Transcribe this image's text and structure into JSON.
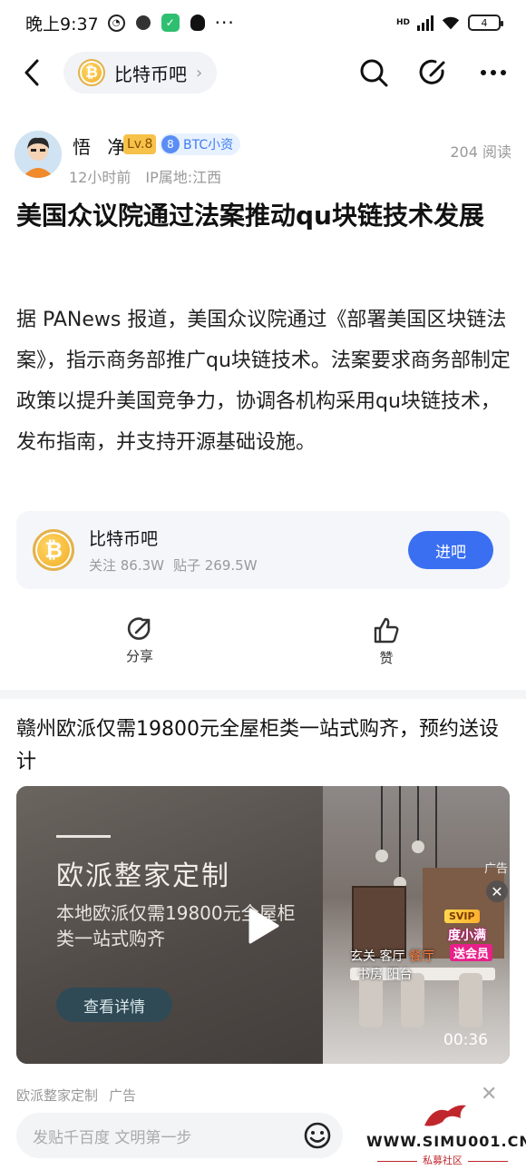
{
  "status_bar": {
    "time": "晚上9:37",
    "battery": "4",
    "network": "HD"
  },
  "nav": {
    "forum_name": "比特币吧",
    "chevron": "›"
  },
  "author": {
    "name": "悟 净",
    "level": "Lv.8",
    "title_num": "8",
    "title": "BTC小资",
    "time_ago": "12小时前",
    "ip_location": "IP属地:江西",
    "views": "204 阅读"
  },
  "post": {
    "title": "美国众议院通过法案推动qu块链技术发展",
    "body": "据 PANews 报道，美国众议院通过《部署美国区块链法案》，指示商务部推广qu块链技术。法案要求商务部制定政策以提升美国竞争力，协调各机构采用qu块链技术，发布指南，并支持开源基础设施。"
  },
  "forum_card": {
    "name": "比特币吧",
    "followers": "关注 86.3W",
    "posts": "贴子 269.5W",
    "join_label": "进吧",
    "coin_symbol": "₿"
  },
  "actions": {
    "share": "分享",
    "like": "赞"
  },
  "ad": {
    "title": "赣州欧派仅需19800元全屋柜类一站式购齐，预约送设计",
    "brand": "欧派整家定制",
    "desc": "本地欧派仅需19800元全屋柜类一站式购齐",
    "cta": "查看详情",
    "ad_mark": "广告",
    "rooms_line1_a": "玄关",
    "rooms_line1_b": "客厅",
    "rooms_line1_c": "餐厅",
    "rooms_line2": "书房 阳台",
    "svip_tag": "SVIP",
    "svip_line1": "度小满",
    "svip_line2": "送会员",
    "duration": "00:36",
    "source": "欧派整家定制",
    "source_tag": "广告"
  },
  "bottom": {
    "input_placeholder": "发贴千百度 文明第一步",
    "watermark_url": "WWW.SIMU001.CN",
    "watermark_sub": "私募社区"
  },
  "colors": {
    "accent": "#3a6ff2",
    "badge_gold": "#f6c24a",
    "watermark_red": "#c0272d"
  }
}
